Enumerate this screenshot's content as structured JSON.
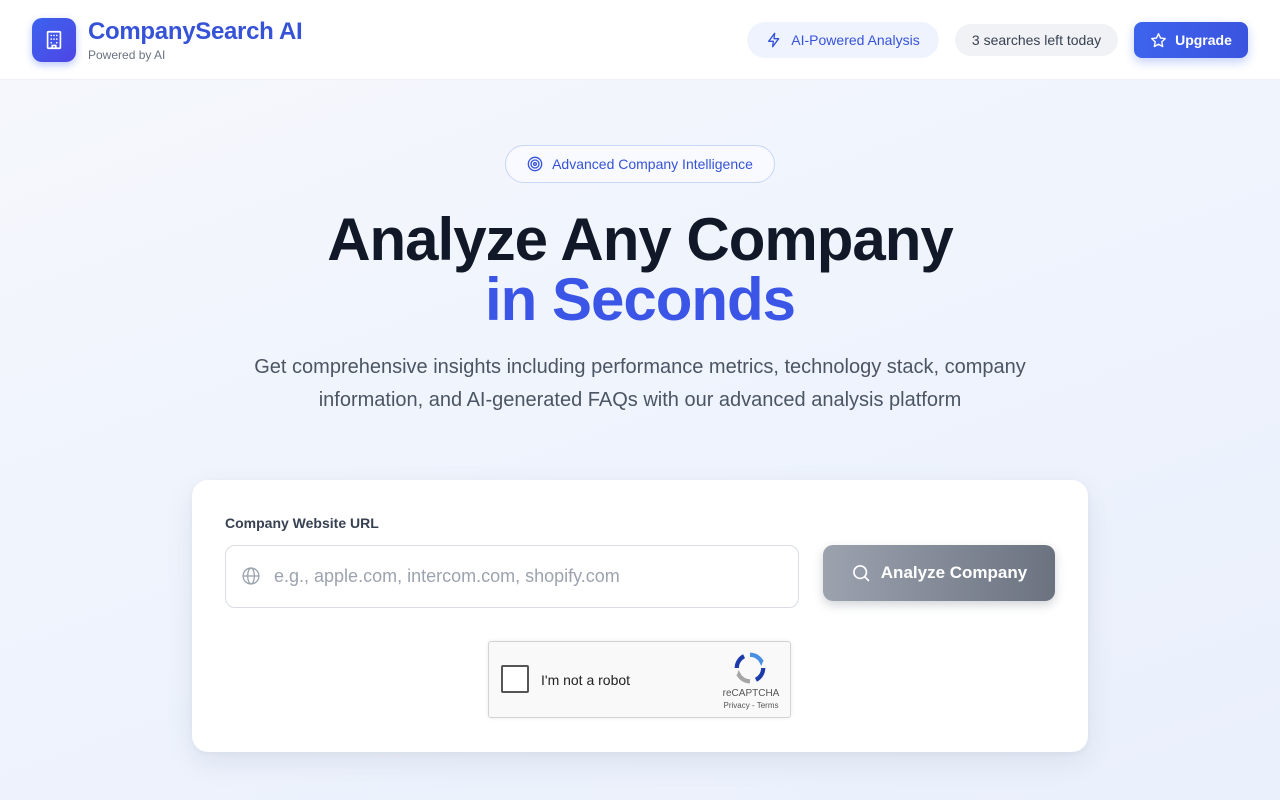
{
  "header": {
    "brand_title": "CompanySearch AI",
    "brand_subtitle": "Powered by AI",
    "ai_pill": "AI-Powered Analysis",
    "searches_left": "3 searches left today",
    "upgrade_label": "Upgrade"
  },
  "hero": {
    "badge": "Advanced Company Intelligence",
    "title_line1": "Analyze Any Company",
    "title_line2": "in Seconds",
    "description": "Get comprehensive insights including performance metrics, technology stack, company information, and AI-generated FAQs with our advanced analysis platform"
  },
  "form": {
    "url_label": "Company Website URL",
    "url_placeholder": "e.g., apple.com, intercom.com, shopify.com",
    "url_value": "",
    "analyze_label": "Analyze Company"
  },
  "recaptcha": {
    "label": "I'm not a robot",
    "brand": "reCAPTCHA",
    "terms": "Privacy - Terms"
  },
  "colors": {
    "accent": "#3b55e6",
    "brand_title": "#3653d8",
    "analyze_button_disabled": "#6b7280"
  },
  "icons": {
    "logo": "building-icon",
    "ai_pill": "bolt-icon",
    "upgrade": "star-icon",
    "badge": "target-icon",
    "url_input": "globe-icon",
    "analyze": "search-icon",
    "recaptcha": "recaptcha-logo-icon"
  }
}
